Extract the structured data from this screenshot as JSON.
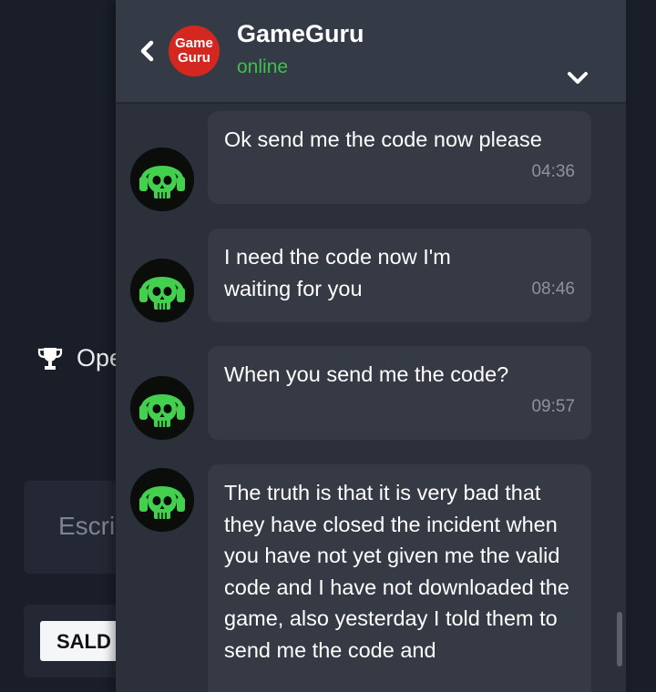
{
  "background": {
    "trophy_label": "Ope",
    "search_placeholder": "Escri",
    "saldo_label": "SALD"
  },
  "chat": {
    "name": "GameGuru",
    "status": "online",
    "logo_line1": "Game",
    "logo_line2": "Guru",
    "messages": [
      {
        "text": "Ok send me the code now please",
        "time": "04:36"
      },
      {
        "text": "I need the code now I'm waiting for you",
        "time": "08:46"
      },
      {
        "text": "When you send me the code?",
        "time": "09:57"
      },
      {
        "text": "The truth is that it is very bad that they have closed the incident when you have not yet given me the valid code and I have not downloaded the game, also yesterday I told them to send me the code and",
        "time": ""
      }
    ]
  },
  "colors": {
    "accent_green": "#3fbf4d",
    "logo_red": "#d3271f",
    "bubble": "#353a45",
    "panel": "#2b303b"
  },
  "icons": {
    "back": "chevron-left-icon",
    "collapse": "chevron-down-icon",
    "trophy": "trophy-icon",
    "avatar": "green-skull-headset-avatar"
  }
}
